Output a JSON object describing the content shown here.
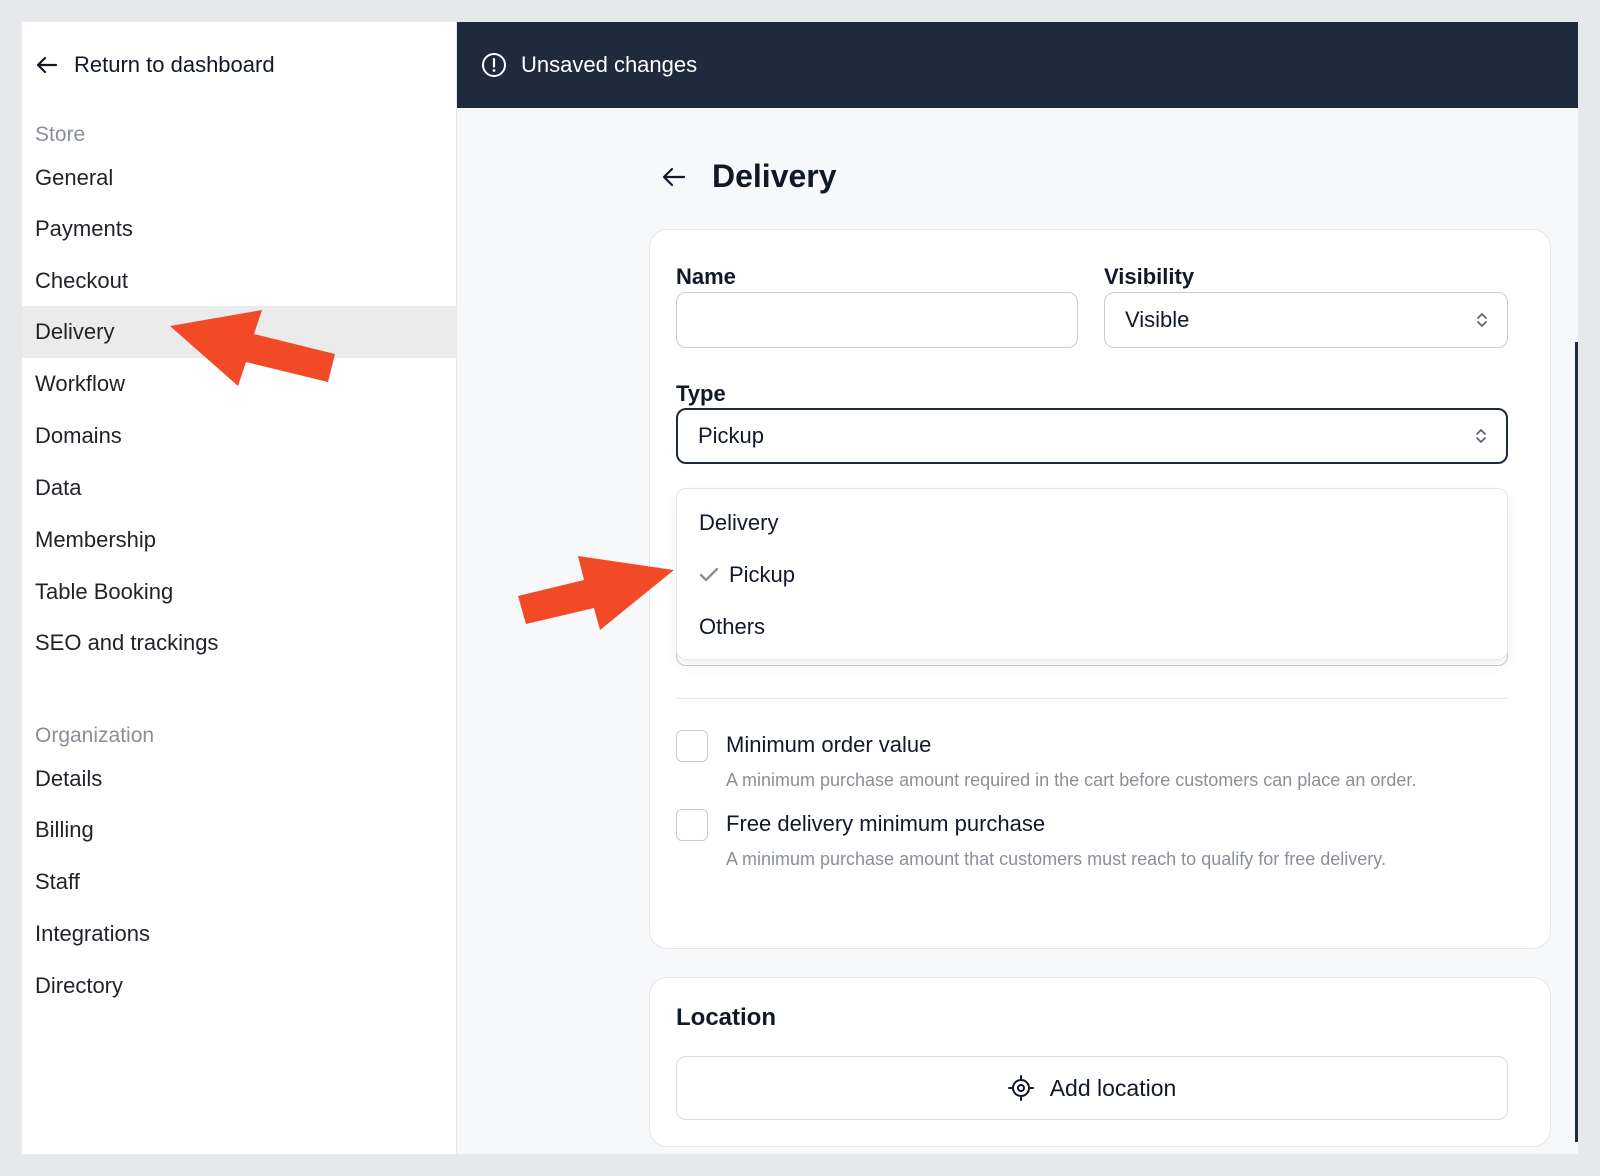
{
  "sidebar": {
    "back_label": "Return to dashboard",
    "store_section": "Store",
    "store_items": [
      {
        "label": "General"
      },
      {
        "label": "Payments"
      },
      {
        "label": "Checkout"
      },
      {
        "label": "Delivery",
        "active": true
      },
      {
        "label": "Workflow"
      },
      {
        "label": "Domains"
      },
      {
        "label": "Data"
      },
      {
        "label": "Membership"
      },
      {
        "label": "Table Booking"
      },
      {
        "label": "SEO and trackings"
      }
    ],
    "org_section": "Organization",
    "org_items": [
      {
        "label": "Details"
      },
      {
        "label": "Billing"
      },
      {
        "label": "Staff"
      },
      {
        "label": "Integrations"
      },
      {
        "label": "Directory"
      }
    ]
  },
  "topbar": {
    "status_text": "Unsaved changes"
  },
  "page": {
    "title": "Delivery"
  },
  "form": {
    "name_label": "Name",
    "name_value": "",
    "visibility_label": "Visibility",
    "visibility_value": "Visible",
    "type_label": "Type",
    "type_value": "Pickup",
    "type_options": [
      {
        "label": "Delivery",
        "selected": false
      },
      {
        "label": "Pickup",
        "selected": true
      },
      {
        "label": "Others",
        "selected": false
      }
    ],
    "min_order_title": "Minimum order value",
    "min_order_desc": "A minimum purchase amount required in the cart before customers can place an order.",
    "free_delivery_title": "Free delivery minimum purchase",
    "free_delivery_desc": "A minimum purchase amount that customers must reach to qualify for free delivery."
  },
  "location": {
    "title": "Location",
    "add_label": "Add location"
  },
  "colors": {
    "topbar_bg": "#1f2a3c",
    "annotation_arrow": "#f24a26",
    "active_nav_bg": "#ebebeb"
  }
}
